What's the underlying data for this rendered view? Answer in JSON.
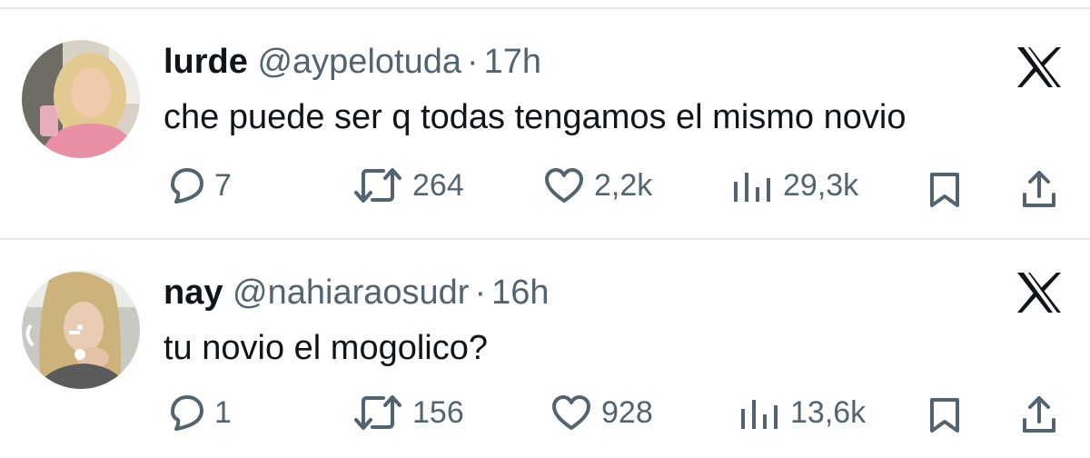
{
  "tweets": [
    {
      "name": "lurde",
      "handle": "@aypelotuda",
      "separator": "·",
      "time": "17h",
      "text": "che puede ser q todas tengamos el mismo novio",
      "replies": "7",
      "retweets": "264",
      "likes": "2,2k",
      "views": "29,3k"
    },
    {
      "name": "nay",
      "handle": "@nahiaraosudr",
      "separator": "·",
      "time": "16h",
      "text": "tu novio el mogolico?",
      "replies": "1",
      "retweets": "156",
      "likes": "928",
      "views": "13,6k"
    }
  ],
  "icons": {
    "brand": "x-logo-icon",
    "reply": "reply-icon",
    "retweet": "retweet-icon",
    "like": "heart-icon",
    "views": "views-icon",
    "bookmark": "bookmark-icon",
    "share": "share-icon"
  },
  "colors": {
    "text": "#0f1419",
    "secondary": "#536471",
    "divider": "#e6e9ec"
  }
}
